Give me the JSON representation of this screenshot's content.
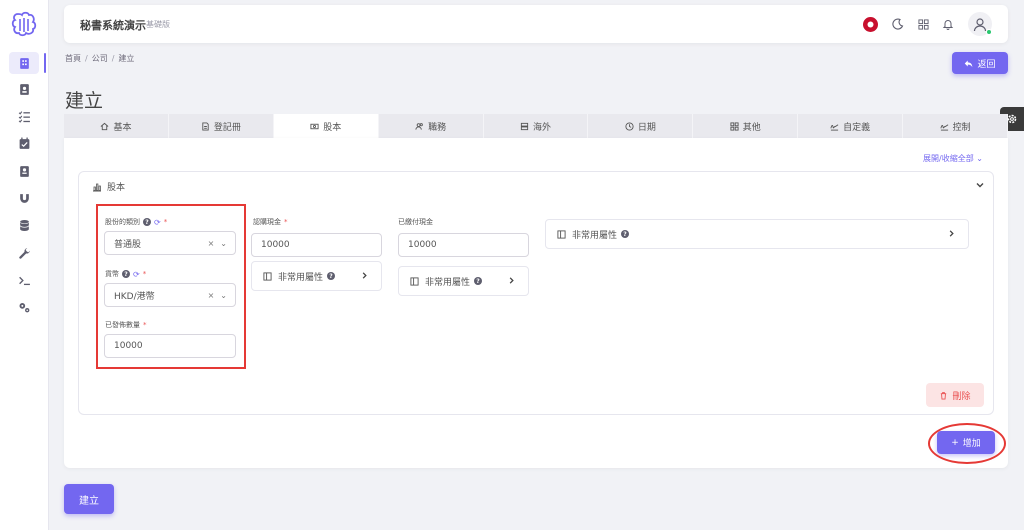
{
  "app": {
    "title": "秘書系統演示",
    "edition": "基礎版"
  },
  "breadcrumb": [
    "首頁",
    "公司",
    "建立"
  ],
  "page_title": "建立",
  "back_label": "返回",
  "tabs": [
    {
      "label": "基本",
      "icon": "home-icon"
    },
    {
      "label": "登記冊",
      "icon": "document-icon"
    },
    {
      "label": "股本",
      "icon": "banknote-icon"
    },
    {
      "label": "職務",
      "icon": "users-icon"
    },
    {
      "label": "海外",
      "icon": "server-icon"
    },
    {
      "label": "日期",
      "icon": "clock-icon"
    },
    {
      "label": "其他",
      "icon": "grid-icon"
    },
    {
      "label": "自定義",
      "icon": "signature-icon"
    },
    {
      "label": "控制",
      "icon": "signature-icon"
    }
  ],
  "expand_all": "展開/收縮全部",
  "section": {
    "title": "股本",
    "share_class": {
      "label": "股份的類別",
      "value": "普通股"
    },
    "currency": {
      "label": "貨幣",
      "value": "HKD/港幣"
    },
    "issued_qty": {
      "label": "已發佈數量",
      "value": "10000"
    },
    "subscribed": {
      "label": "認購現金",
      "value": "10000"
    },
    "paid": {
      "label": "已繳付現金",
      "value": "10000"
    },
    "uncommon_label": "非常用屬性",
    "delete_label": "刪除"
  },
  "add_label": "增加",
  "create_label": "建立",
  "colors": {
    "primary": "#7367f0",
    "danger": "#ea5455",
    "highlight": "#e53935"
  }
}
